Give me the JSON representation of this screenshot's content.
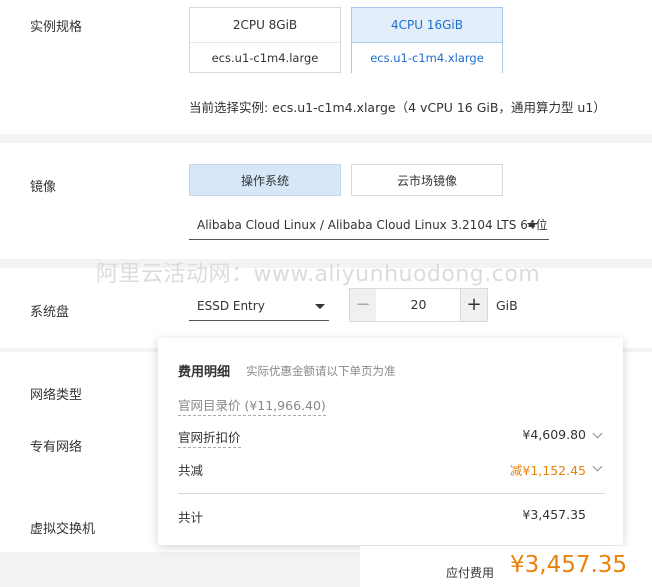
{
  "spec": {
    "label": "实例规格",
    "options": [
      {
        "top": "2CPU 8GiB",
        "bottom": "ecs.u1-c1m4.large"
      },
      {
        "top": "4CPU 16GiB",
        "bottom": "ecs.u1-c1m4.xlarge"
      }
    ],
    "current": "当前选择实例: ecs.u1-c1m4.xlarge（4 vCPU 16 GiB，通用算力型 u1）"
  },
  "image": {
    "label": "镜像",
    "tabs": [
      "操作系统",
      "云市场镜像"
    ],
    "os_value": "Alibaba Cloud Linux / Alibaba Cloud Linux 3.2104 LTS 64位"
  },
  "watermark": "阿里云活动网：www.aliyunhuodong.com",
  "disk": {
    "label": "系统盘",
    "type": "ESSD Entry",
    "minus": "−",
    "size": "20",
    "plus": "+",
    "unit": "GiB"
  },
  "network": {
    "type_label": "网络类型",
    "vpc_label": "专有网络",
    "vswitch_label": "虚拟交换机"
  },
  "cost_popover": {
    "title": "费用明细",
    "note": "实际优惠金额请以下单页为准",
    "list_price": "官网目录价 (¥11,966.40)",
    "discount_label": "官网折扣价",
    "discount_value": "¥4,609.80",
    "saving_label": "共减",
    "saving_value": "减¥1,152.45",
    "total_label": "共计",
    "total_value": "¥3,457.35"
  },
  "footer": {
    "label": "应付费用",
    "amount": "¥3,457.35"
  },
  "colors": {
    "accent_blue": "#1d6fce",
    "orange": "#e8820c"
  }
}
